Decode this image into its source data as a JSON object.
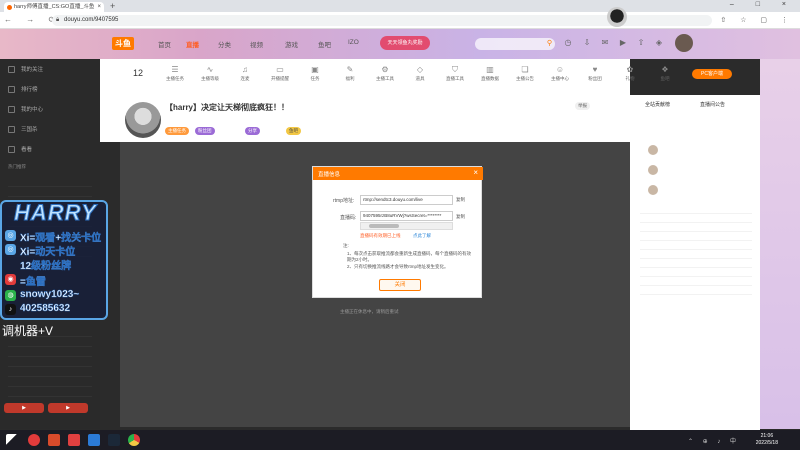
{
  "browser": {
    "tab_title": "harry师傅直播_CS:GO直播_斗鱼",
    "tab_close": "×",
    "new_tab": "+",
    "window_controls": "– □ ×",
    "nav_buttons": "← → ⟳",
    "url": "douyu.com/9407595",
    "extensions": "⇧ ☆ ▢ ⋮"
  },
  "site_header": {
    "logo": "斗鱼",
    "nav": [
      "首页",
      "直播",
      "分类",
      "视频",
      "游戏",
      "鱼吧",
      "IZO"
    ],
    "active_nav": "直播",
    "promo": "天天领鱼丸奖励"
  },
  "room_toolbar": {
    "level": "12",
    "tools": [
      "主播任务",
      "主播等级",
      "连麦",
      "开播提醒",
      "任务",
      "福利",
      "主播工具",
      "道具",
      "直播工具",
      "直播数据",
      "主播公告",
      "主播中心",
      "粉丝团",
      "礼物",
      "鱼吧",
      "更多"
    ],
    "vip_badge": "PC客户端"
  },
  "room": {
    "title": "【harry】决定让天梯彻底疯狂！！",
    "tags": [
      "主播任务",
      "粉丝团",
      "分享",
      "鱼吧",
      "举报"
    ],
    "video_hint": "主播正在休息中，请稍后重试"
  },
  "dialog": {
    "title": "直播信息",
    "close": "×",
    "rtmp_label": "rtmp地址:",
    "rtmp_value": "rtmp://sendtc3.douyu.com/live",
    "copy1": "复制",
    "code_label": "直播码:",
    "code_value": "9407595rzB8uRVWj?wsSecret=********",
    "copy2": "复制",
    "warn": "直播码有效期已上线",
    "learn_more": "点此了解",
    "notes_title": "注:",
    "notes": [
      "1、每次点击获取推流都会重新生成直播码，每个直播码的有效期为2小时。",
      "2、只有切换推流线路才会导致rtmp地址发生变化。"
    ],
    "button": "关闭"
  },
  "sidebar": {
    "items": [
      "我的关注",
      "排行榜",
      "我的中心",
      "三国杀",
      "看看"
    ],
    "group_title": "热门推荐"
  },
  "overlay": {
    "brand": "HARRY",
    "lines": [
      "Xi=观看+找关卡位",
      "Xi=动天卡位",
      "12级粉丝牌",
      "=鱼雷",
      "snowy1023~",
      "402585632"
    ],
    "tiaoji": "调机器+V"
  },
  "rightpanel": {
    "rank_title": "全站贡献榜",
    "chat_title": "直播间公告"
  },
  "taskbar": {
    "time": "21:06",
    "date": "2022/5/18",
    "tray": "⌃ ⊕ ♪ 中"
  },
  "colors": {
    "accent": "#ff7a00",
    "warn": "#ff5d23",
    "link": "#2b86d8"
  }
}
